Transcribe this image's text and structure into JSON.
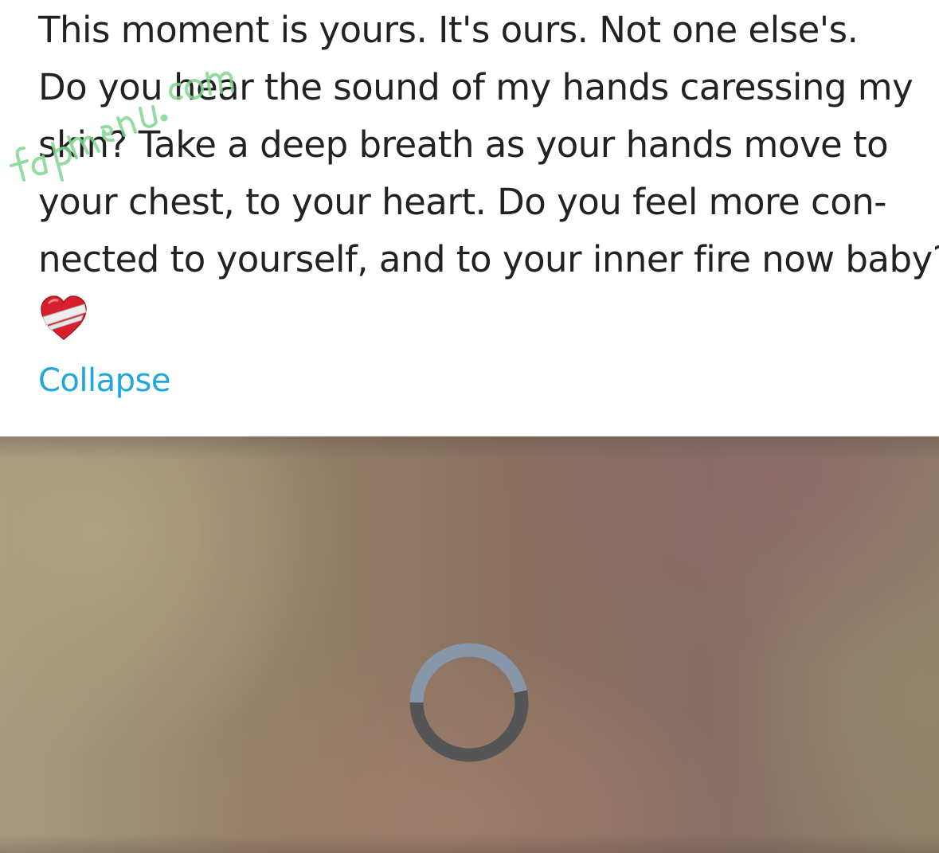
{
  "post": {
    "lines": [
      "This moment is yours. It's ours. Not one else's.",
      "Do you hear the sound of my hands caressing my",
      "skin? Take a deep breath as your hands move to",
      "your chest, to your heart. Do you feel more con-",
      "nected to yourself, and to your inner fire now baby?"
    ],
    "emoji": "mending-heart-emoji",
    "collapse_label": "Collapse"
  },
  "watermark": {
    "text": "fapmenu.com",
    "color": "#7fd68f"
  },
  "media": {
    "loading_icon": "spinner-icon",
    "loading_progress": 0.5
  },
  "colors": {
    "body_text": "#222222",
    "link": "#1ea7d8",
    "spinner_dark": "#555555",
    "spinner_light": "#8796a8"
  }
}
